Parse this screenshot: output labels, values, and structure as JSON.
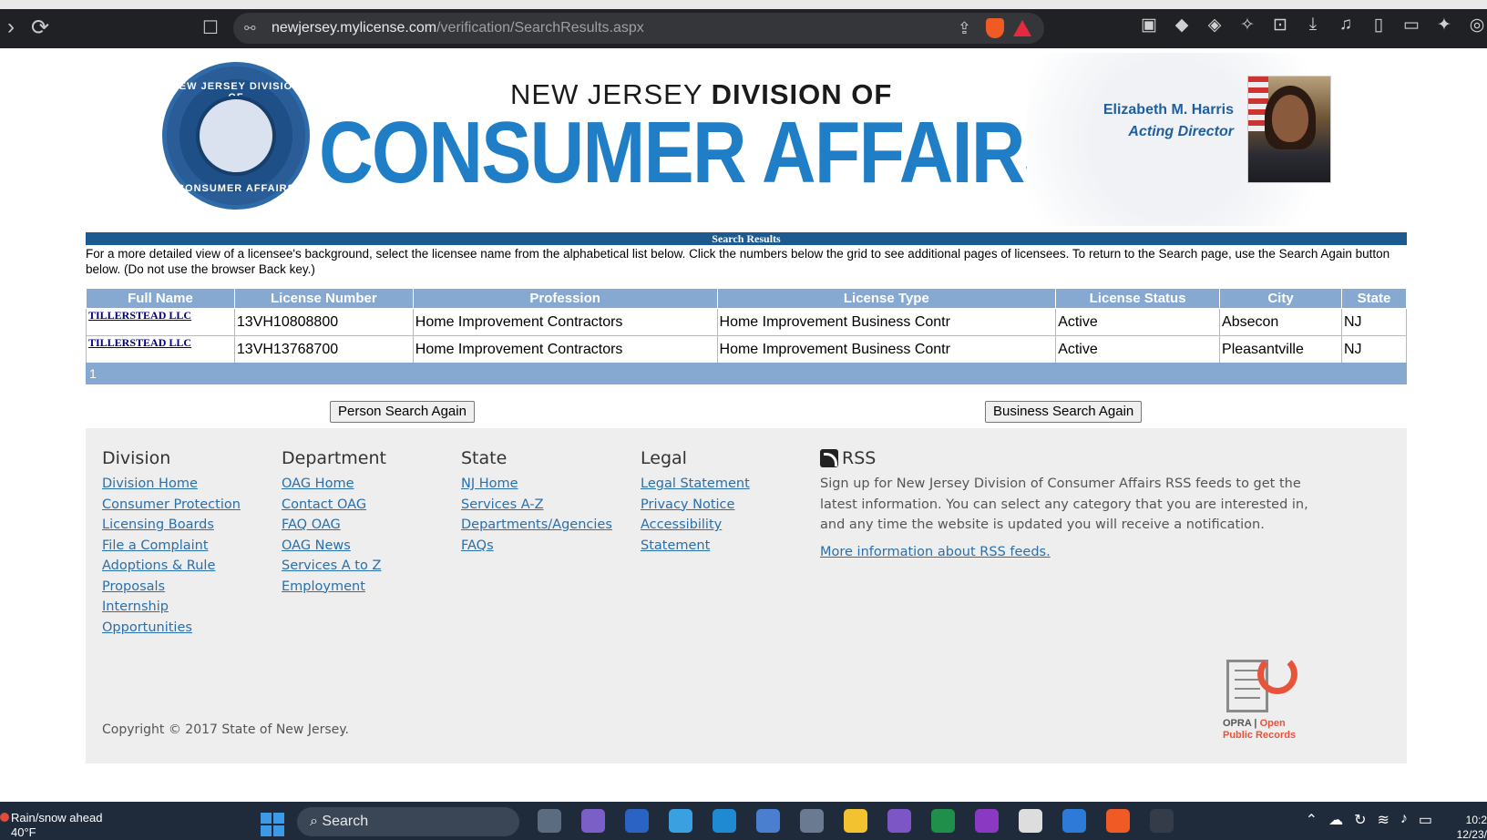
{
  "browser": {
    "url_host": "newjersey.mylicense.com",
    "url_path": "/verification/SearchResults.aspx"
  },
  "header": {
    "agency_line_prefix": "NEW JERSEY ",
    "agency_line_bold": "DIVISION OF",
    "agency_main": "CONSUMER AFFAIRS",
    "seal_top": "NEW JERSEY DIVISION OF",
    "seal_bottom": "CONSUMER AFFAIRS",
    "director_name": "Elizabeth M. Harris",
    "director_title": "Acting Director"
  },
  "results": {
    "bar_title": "Search Results",
    "instructions": "For a more detailed view of a licensee's background, select the licensee name from the alphabetical list below. Click the numbers below the grid to see additional pages of licensees. To return to the Search page, use the Search Again button below. (Do not use the browser Back key.)",
    "columns": [
      "Full Name",
      "License Number",
      "Profession",
      "License Type",
      "License Status",
      "City",
      "State"
    ],
    "rows": [
      {
        "name": "TILLERSTEAD LLC",
        "license_number": "13VH10808800",
        "profession": "Home Improvement Contractors",
        "license_type": "Home Improvement Business Contr",
        "status": "Active",
        "city": "Absecon",
        "state": "NJ"
      },
      {
        "name": "TILLERSTEAD LLC",
        "license_number": "13VH13768700",
        "profession": "Home Improvement Contractors",
        "license_type": "Home Improvement Business Contr",
        "status": "Active",
        "city": "Pleasantville",
        "state": "NJ"
      }
    ],
    "page": "1",
    "person_search_label": "Person Search Again",
    "business_search_label": "Business Search Again"
  },
  "footer": {
    "division": {
      "heading": "Division",
      "links": [
        "Division Home",
        "Consumer Protection",
        "Licensing Boards",
        "File a Complaint",
        "Adoptions & Rule",
        "Proposals",
        "Internship",
        "Opportunities"
      ]
    },
    "department": {
      "heading": "Department",
      "links": [
        "OAG Home",
        "Contact OAG",
        "FAQ OAG",
        "OAG News",
        "Services A to Z",
        "Employment"
      ]
    },
    "state": {
      "heading": "State",
      "links": [
        "NJ Home",
        "Services A-Z",
        "Departments/Agencies",
        "FAQs"
      ]
    },
    "legal": {
      "heading": "Legal",
      "links": [
        "Legal Statement",
        "Privacy Notice",
        "Accessibility",
        "Statement"
      ]
    },
    "rss": {
      "heading": "RSS",
      "text": "Sign up for New Jersey Division of Consumer Affairs RSS feeds to get the latest information. You can select any category that you are interested in, and any time the website is updated you will receive a notification.",
      "more": "More information about RSS feeds."
    },
    "copyright": "Copyright © 2017 State of New Jersey.",
    "opra_line1_a": "OPRA",
    "opra_line1_b": "Open",
    "opra_line2": "Public Records"
  },
  "taskbar": {
    "weather_title": "Rain/snow ahead",
    "weather_temp": "40°F",
    "search_placeholder": "Search",
    "time": "10:2",
    "date": "12/23/"
  },
  "colors": {
    "header_blue": "#1c5a8f",
    "grid_header": "#85a9d1",
    "link_blue": "#2a6faa",
    "brand_blue": "#1f7ec6"
  }
}
